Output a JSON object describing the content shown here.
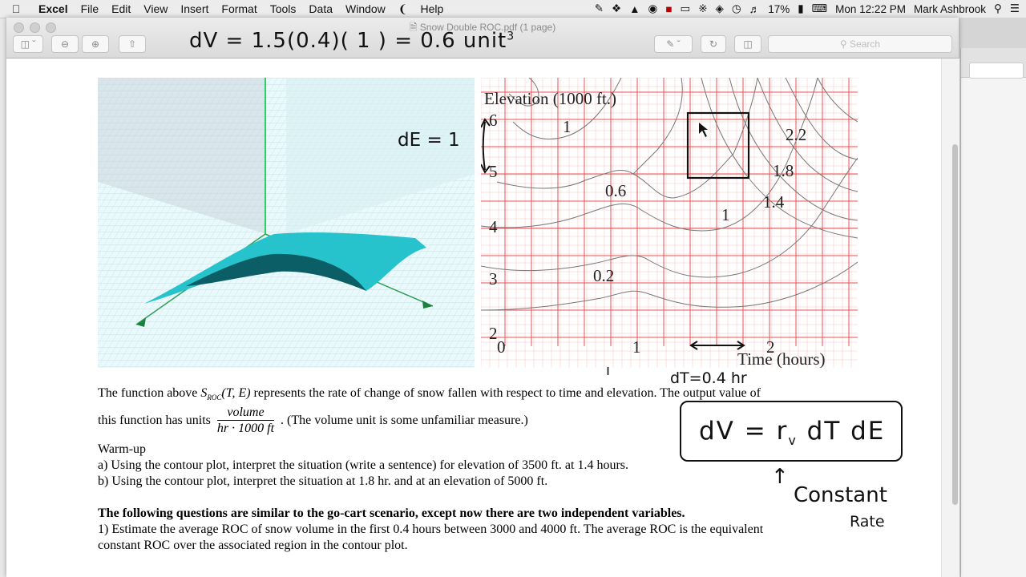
{
  "menubar": {
    "app": "Excel",
    "items": [
      "File",
      "Edit",
      "View",
      "Insert",
      "Format",
      "Tools",
      "Data",
      "Window",
      "Help"
    ],
    "battery": "17%",
    "clock": "Mon 12:22 PM",
    "user": "Mark Ashbrook"
  },
  "window": {
    "title": "Snow Double ROC.pdf (1 page)",
    "search_placeholder": "Search"
  },
  "handwriting": {
    "top_equation": "dV = 1.5(0.4)( 1 )  =  0.6 unit",
    "top_exponent": "3",
    "dE": "dE = 1",
    "dT": "dT=0.4 hr",
    "box_equation": "dV = r",
    "box_sub": "v",
    "box_rest": "dT dE",
    "constant": "Constant",
    "rate": "Rate"
  },
  "contour": {
    "ylabel": "Elevation (1000 ft.)",
    "xlabel": "Time (hours)",
    "yticks": [
      "6",
      "5",
      "4",
      "3",
      "2"
    ],
    "xticks": [
      "0",
      "1",
      "2"
    ],
    "levels": [
      "1",
      "0.6",
      "0.2",
      "2.2",
      "1.8",
      "1.4",
      "1"
    ]
  },
  "document": {
    "line1_a": "The function above",
    "line1_s": "S",
    "line1_sub": "ROC",
    "line1_args": "(T, E)",
    "line1_b": "represents the rate of change of snow fallen with respect to time and elevation.  The output value of",
    "line2_a": "this function has units",
    "frac_num": "volume",
    "frac_den": "hr · 1000 ft",
    "line2_b": ".  (The volume unit is some unfamiliar measure.)",
    "warmup": "Warm-up",
    "qa": "a) Using the contour plot, interpret the situation (write a sentence) for elevation of 3500 ft. at 1.4 hours.",
    "qb": "b) Using the contour plot, interpret the situation at 1.8 hr. and at an elevation of 5000 ft.",
    "bold": "The following questions are similar to the go-cart scenario, except now there are two independent variables.",
    "q1a": "1)  Estimate the average ROC of snow volume in the first 0.4 hours between 3000 and 4000 ft.  The average ROC is the equivalent",
    "q1b": "constant ROC over the associated region in the contour plot."
  }
}
